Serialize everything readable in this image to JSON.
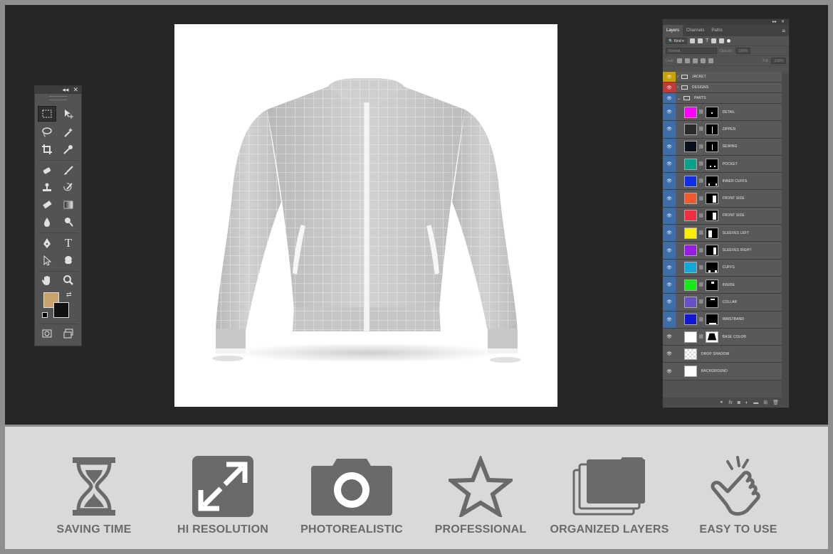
{
  "toolbox": {
    "collapse_icon": "double-chevron-left-icon",
    "close_icon": "close-icon",
    "foreground_color": "#c9a26e",
    "background_color": "#111111"
  },
  "layers_panel": {
    "tabs": [
      "Layers",
      "Channels",
      "Paths"
    ],
    "active_tab": "Layers",
    "filter_label": "Kind",
    "blend_mode": "Normal",
    "opacity_label": "Opacity:",
    "opacity_value": "100%",
    "lock_label": "Lock:",
    "fill_label": "Fill:",
    "fill_value": "100%",
    "layers": [
      {
        "name": "JACKET",
        "type": "group",
        "eye_color": "#c8a000"
      },
      {
        "name": "DESIGNS",
        "type": "group",
        "eye_color": "#c0393b"
      },
      {
        "name": "PARTS",
        "type": "group-open",
        "eye_color": "#3d6ea8"
      },
      {
        "name": "DETAIL",
        "color": "#ff00ff",
        "eye_color": "#3d6ea8"
      },
      {
        "name": "ZIPPER",
        "color": "#2a2a2a",
        "eye_color": "#3d6ea8"
      },
      {
        "name": "SEWING",
        "color": "#0a0f1e",
        "eye_color": "#3d6ea8"
      },
      {
        "name": "POCKET",
        "color": "#0aa08a",
        "eye_color": "#3d6ea8"
      },
      {
        "name": "INNER CUFFS",
        "color": "#1030e0",
        "eye_color": "#3d6ea8"
      },
      {
        "name": "FRONT SIDE",
        "color": "#f05a30",
        "eye_color": "#3d6ea8"
      },
      {
        "name": "FRONT SIDE",
        "color": "#f03040",
        "eye_color": "#3d6ea8"
      },
      {
        "name": "SLEEVES LEFT",
        "color": "#ffee00",
        "eye_color": "#3d6ea8"
      },
      {
        "name": "SLEEVES RIGHT",
        "color": "#9a1ae8",
        "eye_color": "#3d6ea8"
      },
      {
        "name": "CUFFS",
        "color": "#10a8d8",
        "eye_color": "#3d6ea8"
      },
      {
        "name": "INSIDE",
        "color": "#10ee10",
        "eye_color": "#3d6ea8"
      },
      {
        "name": "COLLAR",
        "color": "#6a50c8",
        "eye_color": "#3d6ea8"
      },
      {
        "name": "WAISTBAND",
        "color": "#1018d8",
        "eye_color": "#3d6ea8"
      },
      {
        "name": "BASE COLOR",
        "color": "#ffffff",
        "eye_color": "#595959"
      },
      {
        "name": "DROP SHADOW",
        "color": "checker",
        "eye_color": "#595959"
      },
      {
        "name": "BACKGROUND",
        "color": "#ffffff",
        "eye_color": "#595959"
      }
    ]
  },
  "features": [
    {
      "label": "SAVING TIME",
      "icon": "hourglass-icon"
    },
    {
      "label": "HI RESOLUTION",
      "icon": "expand-arrows-icon"
    },
    {
      "label": "PHOTOREALISTIC",
      "icon": "camera-icon"
    },
    {
      "label": "PROFESSIONAL",
      "icon": "star-icon"
    },
    {
      "label": "ORGANIZED LAYERS",
      "icon": "stacked-folders-icon"
    },
    {
      "label": "EASY TO USE",
      "icon": "pointing-hand-icon"
    }
  ],
  "colors": {
    "workspace": "#262626",
    "frame": "#8e8e8e",
    "feature_band": "#d9d9d9",
    "feature_icon": "#6a6a6a"
  }
}
